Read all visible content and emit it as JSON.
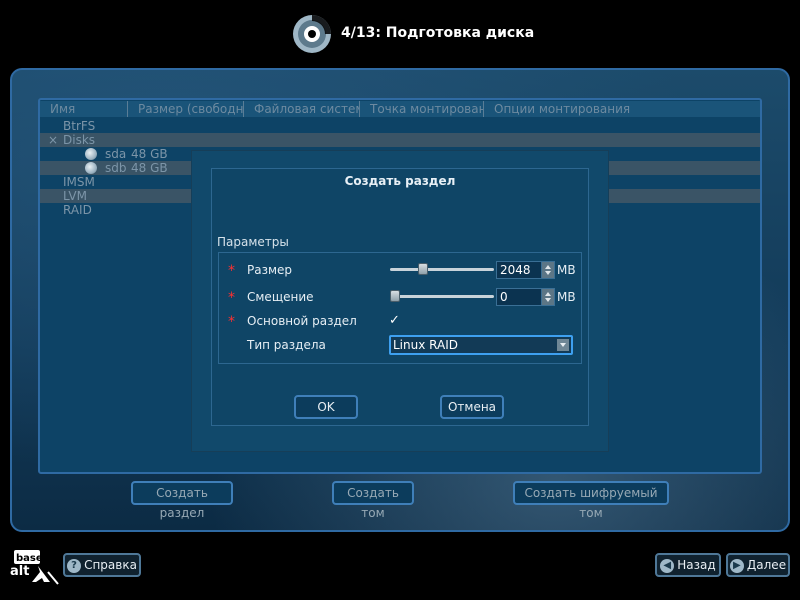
{
  "header": {
    "title": "4/13: Подготовка диска"
  },
  "table": {
    "columns": [
      "Имя",
      "Размер (свободно)",
      "Файловая система",
      "Точка монтирования",
      "Опции монтирования"
    ],
    "rows": [
      {
        "name": "BtrFS",
        "size": ""
      },
      {
        "name": "Disks",
        "size": "",
        "expander": "×"
      },
      {
        "name": "sda",
        "size": "48 GB"
      },
      {
        "name": "sdb",
        "size": "48 GB"
      },
      {
        "name": "IMSM",
        "size": ""
      },
      {
        "name": "LVM",
        "size": ""
      },
      {
        "name": "RAID",
        "size": ""
      }
    ]
  },
  "dialog": {
    "title": "Создать раздел",
    "params_label": "Параметры",
    "size_label": "Размер",
    "size_value": "2048",
    "size_unit": "MB",
    "size_slider_fraction": 0.3,
    "offset_label": "Смещение",
    "offset_value": "0",
    "offset_unit": "MB",
    "offset_slider_fraction": 0.0,
    "primary_label": "Основной раздел",
    "primary_checked": "✓",
    "type_label": "Тип раздела",
    "type_value": "Linux RAID",
    "required_mark": "*",
    "ok_label": "OK",
    "cancel_label": "Отмена"
  },
  "actions": {
    "create_partition": "Создать раздел",
    "create_volume": "Создать том",
    "create_encrypted": "Создать шифруемый том"
  },
  "footer": {
    "help_label": "Справка",
    "help_icon": "?",
    "back_label": "Назад",
    "next_label": "Далее",
    "logo_text_top": "base",
    "logo_text_bottom": "alt"
  },
  "colors": {
    "accent": "#3ea0f0",
    "required": "#ff3030",
    "background": "#000000"
  }
}
